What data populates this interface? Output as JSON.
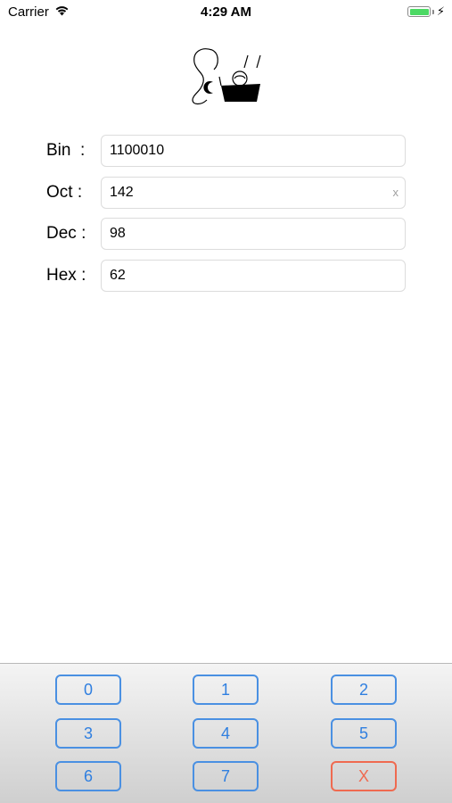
{
  "status_bar": {
    "carrier": "Carrier",
    "time": "4:29 AM",
    "battery_level": 1.0,
    "battery_color": "#4cd964",
    "charging_glyph": "⚡"
  },
  "logo": {
    "icon": "noodle-box-logo"
  },
  "fields": [
    {
      "label": "Bin  :",
      "value": "1100010"
    },
    {
      "label": "Oct :",
      "value": "142",
      "clear": "x"
    },
    {
      "label": "Dec :",
      "value": "98"
    },
    {
      "label": "Hex :",
      "value": "62"
    }
  ],
  "keypad": {
    "keys": [
      "0",
      "1",
      "2",
      "3",
      "4",
      "5",
      "6",
      "7"
    ],
    "clear_key": "X",
    "accent_color": "#4a90e2",
    "clear_color": "#ef6a50"
  }
}
